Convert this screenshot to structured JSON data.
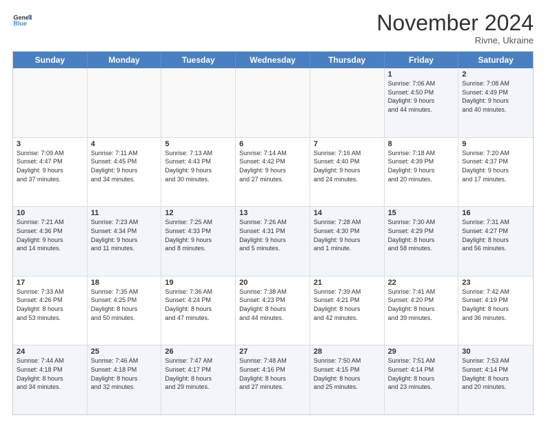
{
  "logo": {
    "line1": "General",
    "line2": "Blue"
  },
  "title": "November 2024",
  "location": "Rivne, Ukraine",
  "weekdays": [
    "Sunday",
    "Monday",
    "Tuesday",
    "Wednesday",
    "Thursday",
    "Friday",
    "Saturday"
  ],
  "rows": [
    [
      {
        "day": "",
        "text": ""
      },
      {
        "day": "",
        "text": ""
      },
      {
        "day": "",
        "text": ""
      },
      {
        "day": "",
        "text": ""
      },
      {
        "day": "",
        "text": ""
      },
      {
        "day": "1",
        "text": "Sunrise: 7:06 AM\nSunset: 4:50 PM\nDaylight: 9 hours\nand 44 minutes."
      },
      {
        "day": "2",
        "text": "Sunrise: 7:08 AM\nSunset: 4:49 PM\nDaylight: 9 hours\nand 40 minutes."
      }
    ],
    [
      {
        "day": "3",
        "text": "Sunrise: 7:09 AM\nSunset: 4:47 PM\nDaylight: 9 hours\nand 37 minutes."
      },
      {
        "day": "4",
        "text": "Sunrise: 7:11 AM\nSunset: 4:45 PM\nDaylight: 9 hours\nand 34 minutes."
      },
      {
        "day": "5",
        "text": "Sunrise: 7:13 AM\nSunset: 4:43 PM\nDaylight: 9 hours\nand 30 minutes."
      },
      {
        "day": "6",
        "text": "Sunrise: 7:14 AM\nSunset: 4:42 PM\nDaylight: 9 hours\nand 27 minutes."
      },
      {
        "day": "7",
        "text": "Sunrise: 7:16 AM\nSunset: 4:40 PM\nDaylight: 9 hours\nand 24 minutes."
      },
      {
        "day": "8",
        "text": "Sunrise: 7:18 AM\nSunset: 4:39 PM\nDaylight: 9 hours\nand 20 minutes."
      },
      {
        "day": "9",
        "text": "Sunrise: 7:20 AM\nSunset: 4:37 PM\nDaylight: 9 hours\nand 17 minutes."
      }
    ],
    [
      {
        "day": "10",
        "text": "Sunrise: 7:21 AM\nSunset: 4:36 PM\nDaylight: 9 hours\nand 14 minutes."
      },
      {
        "day": "11",
        "text": "Sunrise: 7:23 AM\nSunset: 4:34 PM\nDaylight: 9 hours\nand 11 minutes."
      },
      {
        "day": "12",
        "text": "Sunrise: 7:25 AM\nSunset: 4:33 PM\nDaylight: 9 hours\nand 8 minutes."
      },
      {
        "day": "13",
        "text": "Sunrise: 7:26 AM\nSunset: 4:31 PM\nDaylight: 9 hours\nand 5 minutes."
      },
      {
        "day": "14",
        "text": "Sunrise: 7:28 AM\nSunset: 4:30 PM\nDaylight: 9 hours\nand 1 minute."
      },
      {
        "day": "15",
        "text": "Sunrise: 7:30 AM\nSunset: 4:29 PM\nDaylight: 8 hours\nand 58 minutes."
      },
      {
        "day": "16",
        "text": "Sunrise: 7:31 AM\nSunset: 4:27 PM\nDaylight: 8 hours\nand 56 minutes."
      }
    ],
    [
      {
        "day": "17",
        "text": "Sunrise: 7:33 AM\nSunset: 4:26 PM\nDaylight: 8 hours\nand 53 minutes."
      },
      {
        "day": "18",
        "text": "Sunrise: 7:35 AM\nSunset: 4:25 PM\nDaylight: 8 hours\nand 50 minutes."
      },
      {
        "day": "19",
        "text": "Sunrise: 7:36 AM\nSunset: 4:24 PM\nDaylight: 8 hours\nand 47 minutes."
      },
      {
        "day": "20",
        "text": "Sunrise: 7:38 AM\nSunset: 4:23 PM\nDaylight: 8 hours\nand 44 minutes."
      },
      {
        "day": "21",
        "text": "Sunrise: 7:39 AM\nSunset: 4:21 PM\nDaylight: 8 hours\nand 42 minutes."
      },
      {
        "day": "22",
        "text": "Sunrise: 7:41 AM\nSunset: 4:20 PM\nDaylight: 8 hours\nand 39 minutes."
      },
      {
        "day": "23",
        "text": "Sunrise: 7:42 AM\nSunset: 4:19 PM\nDaylight: 8 hours\nand 36 minutes."
      }
    ],
    [
      {
        "day": "24",
        "text": "Sunrise: 7:44 AM\nSunset: 4:18 PM\nDaylight: 8 hours\nand 34 minutes."
      },
      {
        "day": "25",
        "text": "Sunrise: 7:46 AM\nSunset: 4:18 PM\nDaylight: 8 hours\nand 32 minutes."
      },
      {
        "day": "26",
        "text": "Sunrise: 7:47 AM\nSunset: 4:17 PM\nDaylight: 8 hours\nand 29 minutes."
      },
      {
        "day": "27",
        "text": "Sunrise: 7:48 AM\nSunset: 4:16 PM\nDaylight: 8 hours\nand 27 minutes."
      },
      {
        "day": "28",
        "text": "Sunrise: 7:50 AM\nSunset: 4:15 PM\nDaylight: 8 hours\nand 25 minutes."
      },
      {
        "day": "29",
        "text": "Sunrise: 7:51 AM\nSunset: 4:14 PM\nDaylight: 8 hours\nand 23 minutes."
      },
      {
        "day": "30",
        "text": "Sunrise: 7:53 AM\nSunset: 4:14 PM\nDaylight: 8 hours\nand 20 minutes."
      }
    ]
  ],
  "alt_rows": [
    0,
    2,
    4
  ]
}
